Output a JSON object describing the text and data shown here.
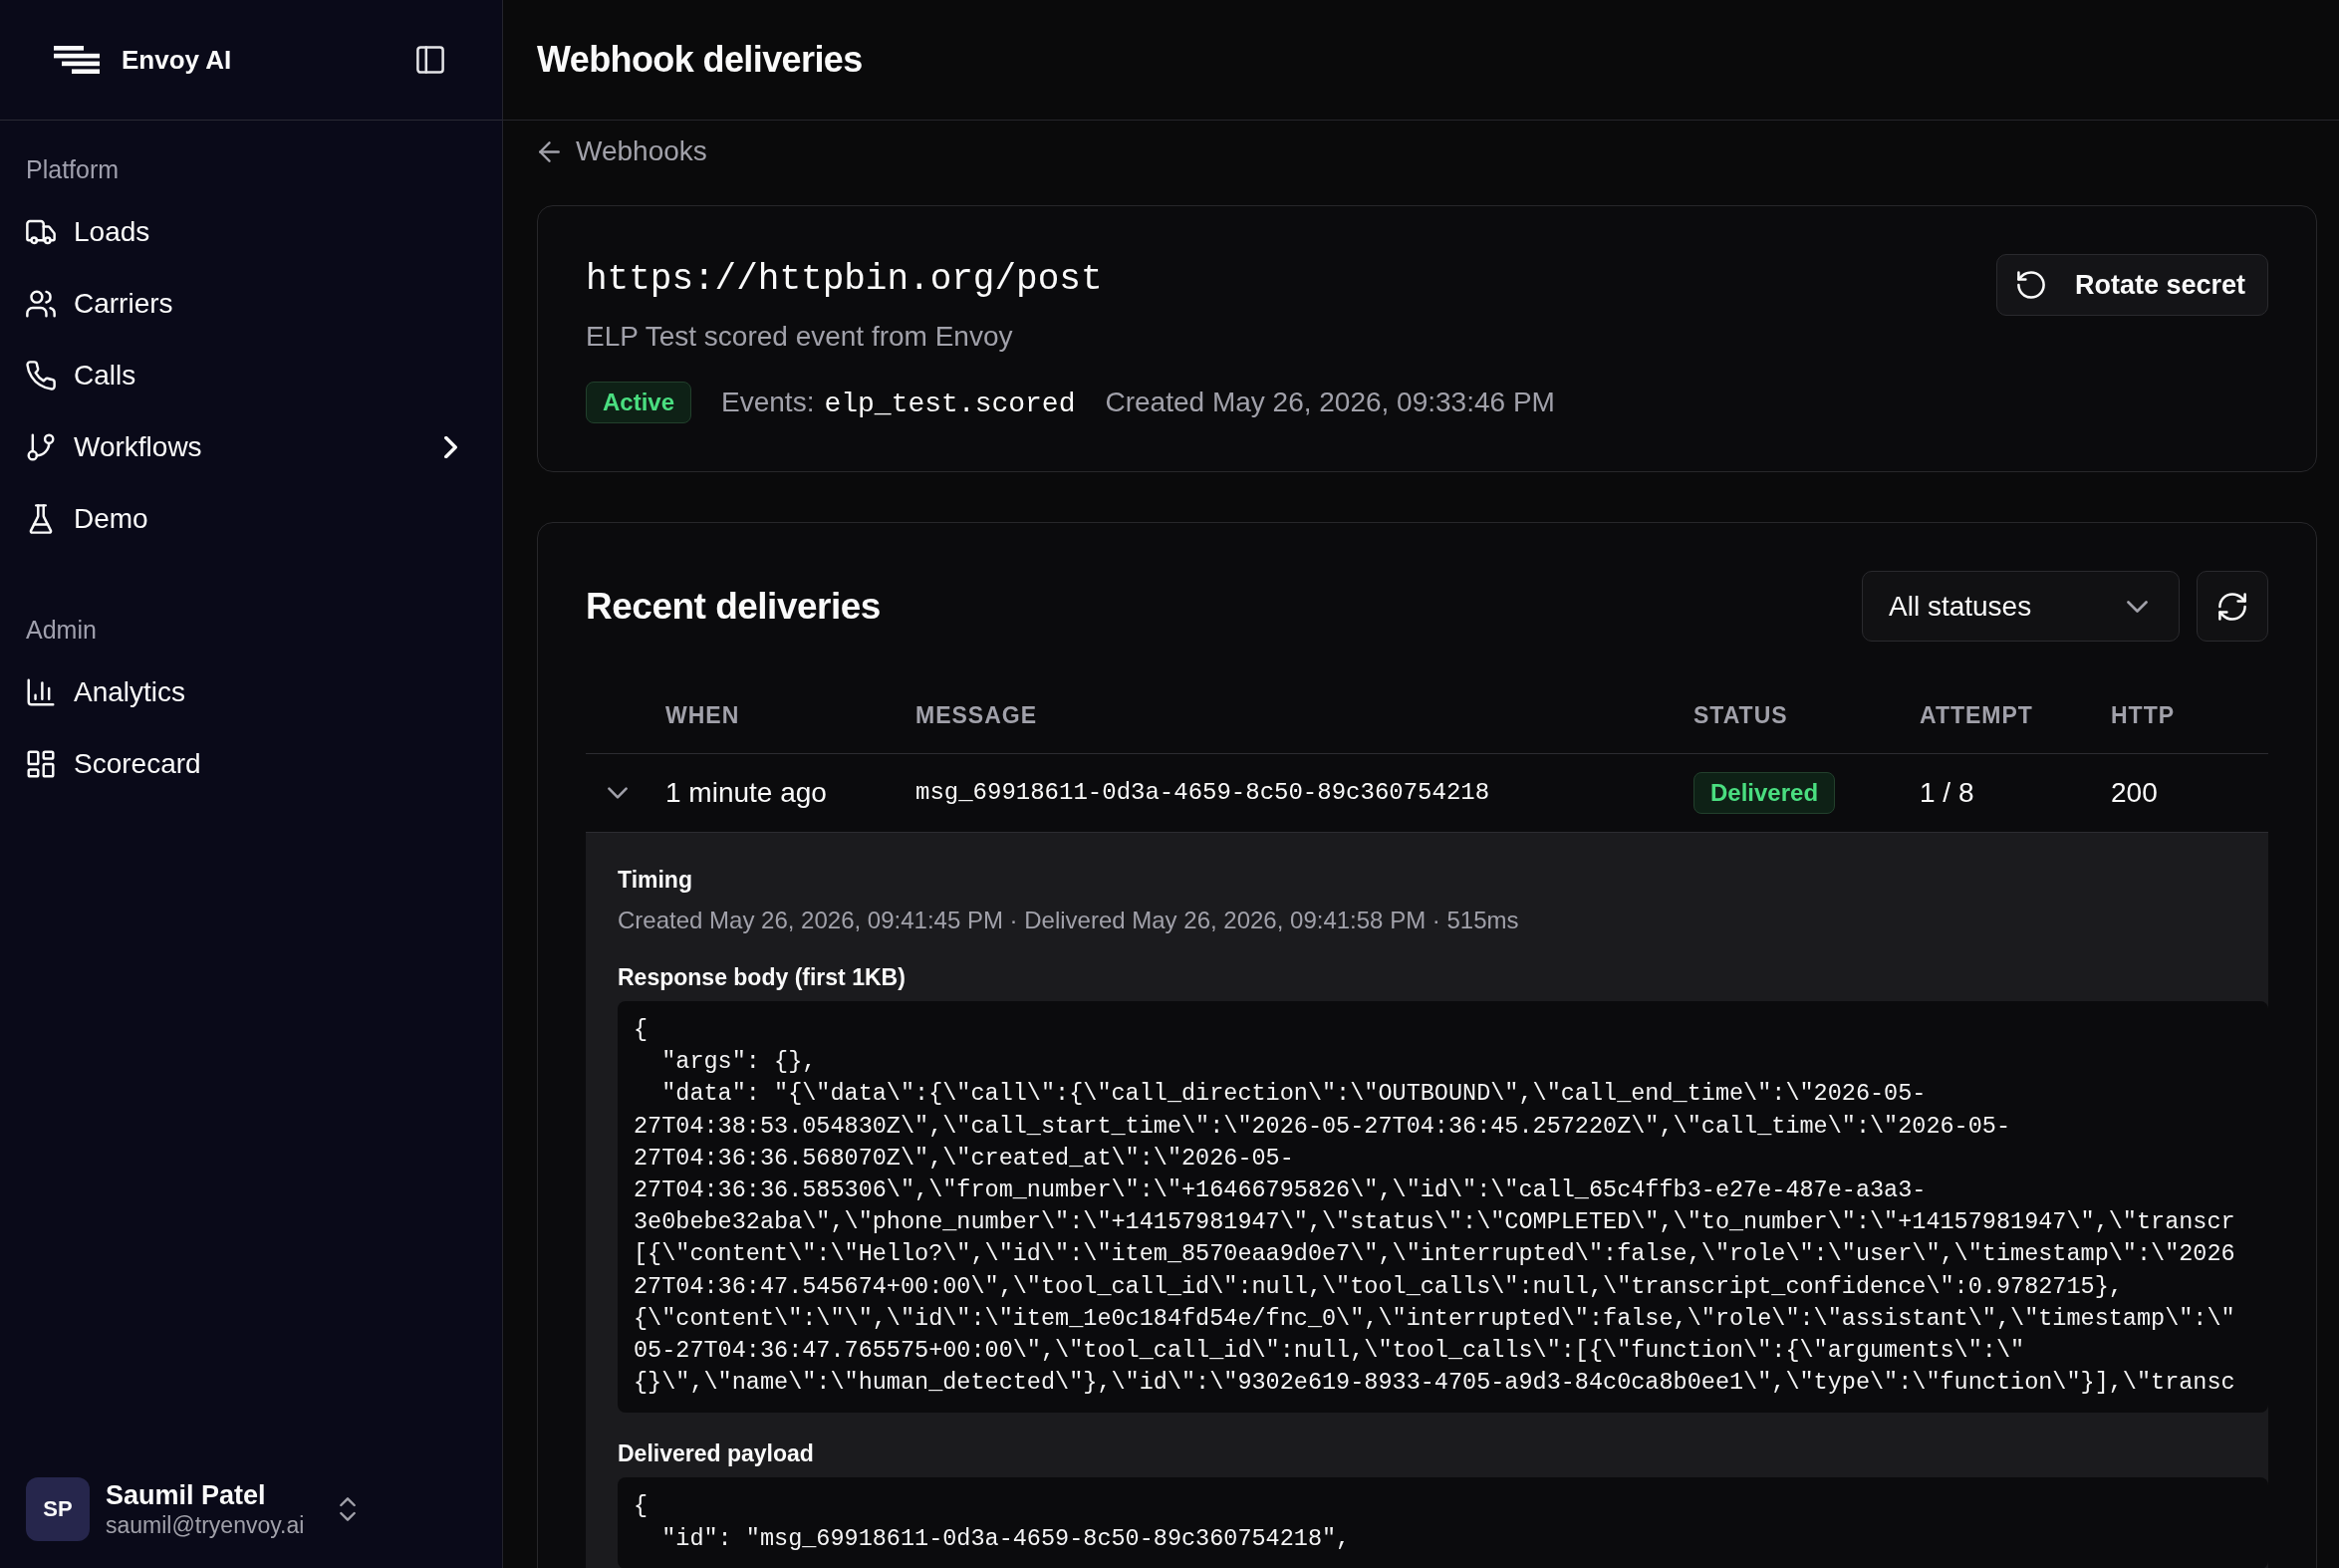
{
  "sidebar": {
    "brand": "Envoy AI",
    "sections": [
      {
        "label": "Platform",
        "items": [
          {
            "label": "Loads",
            "selected": false,
            "has_children": false
          },
          {
            "label": "Carriers",
            "selected": false,
            "has_children": false
          },
          {
            "label": "Calls",
            "selected": false,
            "has_children": false
          },
          {
            "label": "Workflows",
            "selected": false,
            "has_children": true
          },
          {
            "label": "Demo",
            "selected": false,
            "has_children": false
          }
        ]
      },
      {
        "label": "Admin",
        "items": [
          {
            "label": "Analytics",
            "selected": false,
            "has_children": false
          },
          {
            "label": "Scorecard",
            "selected": false,
            "has_children": false
          }
        ]
      }
    ],
    "user": {
      "initials": "SP",
      "name": "Saumil Patel",
      "email": "saumil@tryenvoy.ai"
    }
  },
  "page": {
    "title": "Webhook deliveries",
    "back_link": "Webhooks"
  },
  "webhook": {
    "url": "https://httpbin.org/post",
    "description": "ELP Test scored event from Envoy",
    "status": {
      "text": "Active",
      "kind": "success"
    },
    "events_label": "Events:",
    "event": "elp_test.scored",
    "created": "Created May 26, 2026, 09:33:46 PM",
    "action": "Rotate secret"
  },
  "deliveries": {
    "title": "Recent deliveries",
    "filter": {
      "value": "All statuses"
    },
    "columns": [
      "WHEN",
      "MESSAGE",
      "STATUS",
      "ATTEMPT",
      "HTTP"
    ],
    "rows": [
      {
        "expanded": true,
        "when": "1 minute ago",
        "message": "msg_69918611-0d3a-4659-8c50-89c360754218",
        "status": {
          "text": "Delivered",
          "kind": "success"
        },
        "attempt": "1 / 8",
        "http": "200",
        "details": {
          "timing_label": "Timing",
          "timing": "Created May 26, 2026, 09:41:45 PM · Delivered May 26, 2026, 09:41:58 PM · 515ms",
          "blocks": [
            {
              "label": "Response body (first 1KB)",
              "lines": [
                "{",
                "  \"args\": {},",
                "  \"data\": \"{\\\"data\\\":{\\\"call\\\":{\\\"call_direction\\\":\\\"OUTBOUND\\\",\\\"call_end_time\\\":\\\"2026-05-",
                "27T04:38:53.054830Z\\\",\\\"call_start_time\\\":\\\"2026-05-27T04:36:45.257220Z\\\",\\\"call_time\\\":\\\"2026-05-",
                "27T04:36:36.568070Z\\\",\\\"created_at\\\":\\\"2026-05-",
                "27T04:36:36.585306\\\",\\\"from_number\\\":\\\"+16466795826\\\",\\\"id\\\":\\\"call_65c4ffb3-e27e-487e-a3a3-",
                "3e0bebe32aba\\\",\\\"phone_number\\\":\\\"+14157981947\\\",\\\"status\\\":\\\"COMPLETED\\\",\\\"to_number\\\":\\\"+14157981947\\\",\\\"transcr",
                "[{\\\"content\\\":\\\"Hello?\\\",\\\"id\\\":\\\"item_8570eaa9d0e7\\\",\\\"interrupted\\\":false,\\\"role\\\":\\\"user\\\",\\\"timestamp\\\":\\\"2026",
                "27T04:36:47.545674+00:00\\\",\\\"tool_call_id\\\":null,\\\"tool_calls\\\":null,\\\"transcript_confidence\\\":0.9782715},",
                "{\\\"content\\\":\\\"\\\",\\\"id\\\":\\\"item_1e0c184fd54e/fnc_0\\\",\\\"interrupted\\\":false,\\\"role\\\":\\\"assistant\\\",\\\"timestamp\\\":\\\"",
                "05-27T04:36:47.765575+00:00\\\",\\\"tool_call_id\\\":null,\\\"tool_calls\\\":[{\\\"function\\\":{\\\"arguments\\\":\\\"",
                "{}\\\",\\\"name\\\":\\\"human_detected\\\"},\\\"id\\\":\\\"9302e619-8933-4705-a9d3-84c0ca8b0ee1\\\",\\\"type\\\":\\\"function\\\"}],\\\"transc"
              ]
            },
            {
              "label": "Delivered payload",
              "lines": [
                "{",
                "  \"id\": \"msg_69918611-0d3a-4659-8c50-89c360754218\","
              ]
            }
          ]
        }
      }
    ]
  }
}
